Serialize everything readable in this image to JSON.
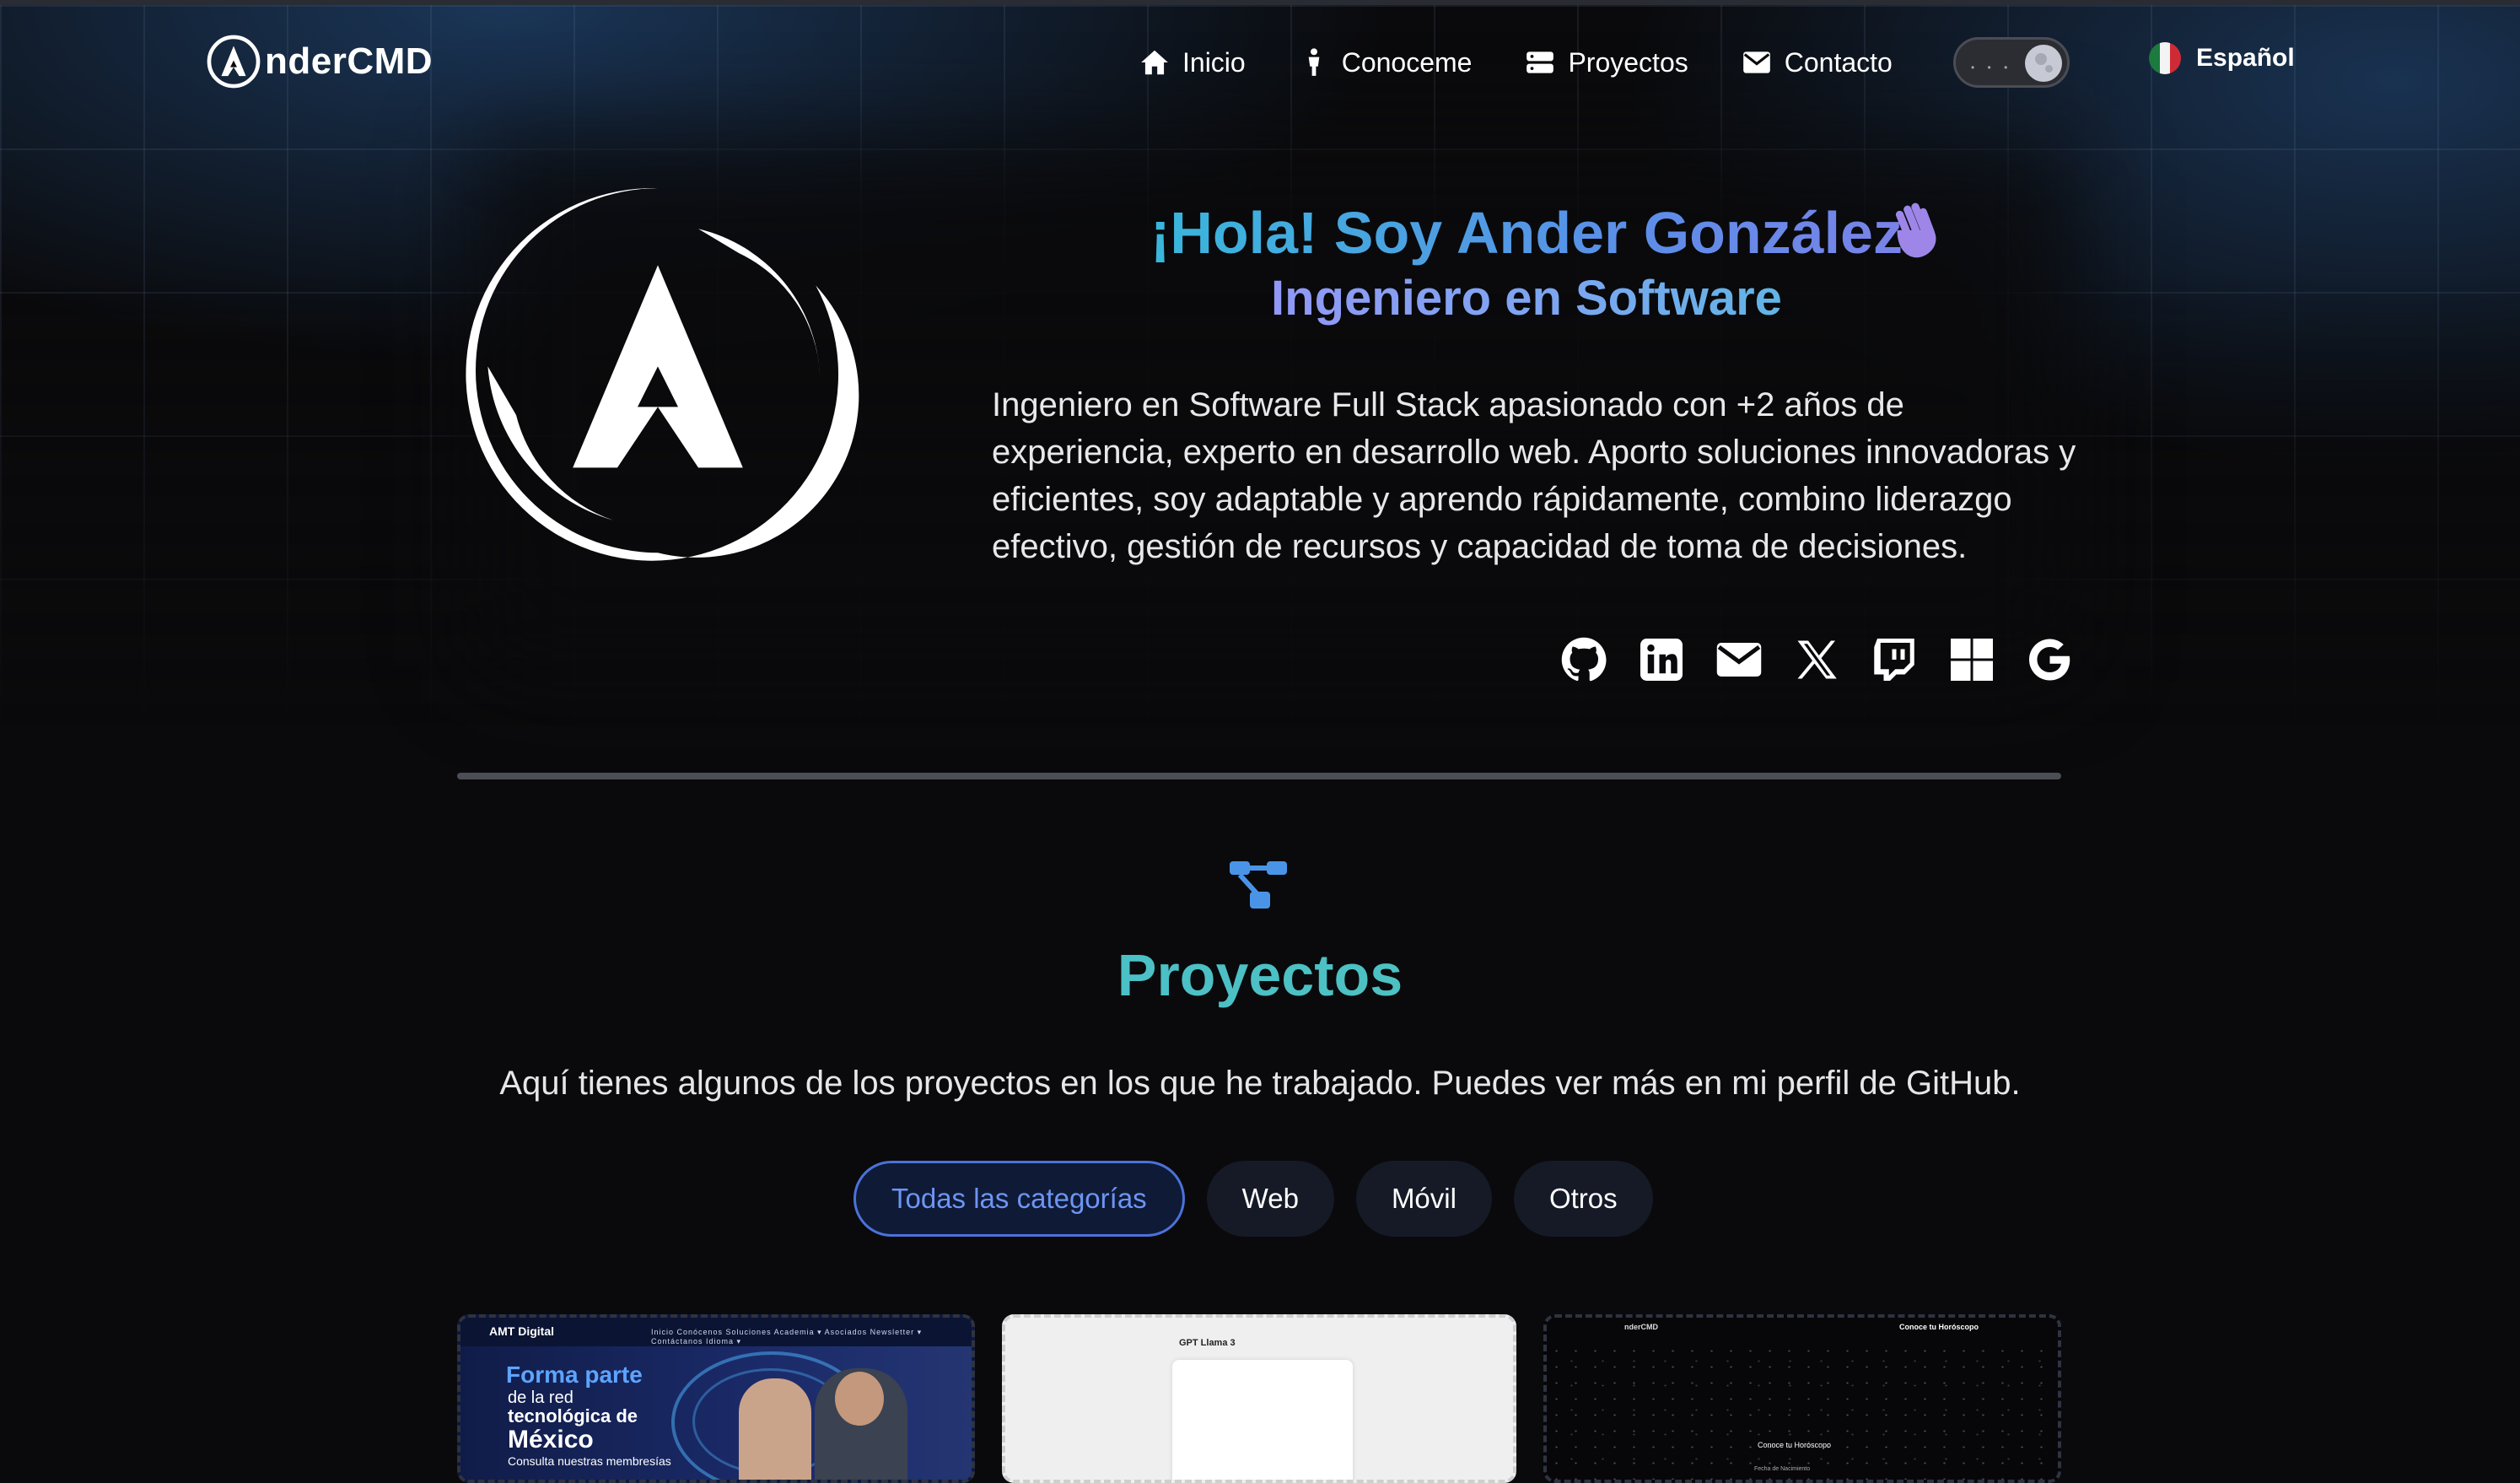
{
  "brand": {
    "name": "nderCMD"
  },
  "nav": {
    "items": [
      {
        "label": "Inicio",
        "icon": "home-icon"
      },
      {
        "label": "Conoceme",
        "icon": "person-icon"
      },
      {
        "label": "Proyectos",
        "icon": "server-icon"
      },
      {
        "label": "Contacto",
        "icon": "envelope-icon"
      }
    ],
    "theme_toggle_icon": "moon-icon",
    "language": "Español"
  },
  "hero": {
    "title": "¡Hola! Soy Ander González",
    "wave_icon": "waving-hand-icon",
    "subtitle": "Ingeniero en Software",
    "description": "Ingeniero en Software Full Stack apasionado con +2 años de experiencia, experto en desarrollo web. Aporto soluciones innovadoras y eficientes, soy adaptable y aprendo rápidamente, combino liderazgo efectivo, gestión de recursos y capacidad de toma de decisiones.",
    "socials": [
      "github-icon",
      "linkedin-icon",
      "email-icon",
      "x-icon",
      "twitch-icon",
      "windows-icon",
      "google-icon"
    ]
  },
  "projects": {
    "title": "Proyectos",
    "description": "Aquí tienes algunos de los proyectos en los que he trabajado. Puedes ver más en mi perfil de GitHub.",
    "filters": [
      "Todas las categorías",
      "Web",
      "Móvil",
      "Otros"
    ],
    "active_filter": "Todas las categorías",
    "cards": [
      {
        "brand": "AMT Digital",
        "nav_links": "Inicio  Conócenos  Soluciones  Academia ▾  Asociados  Newsletter ▾  Contáctanos  Idioma ▾",
        "line1": "Forma parte",
        "line2": "de la red",
        "line3": "tecnológica de",
        "line4": "México",
        "line5": "Consulta nuestras membresías"
      },
      {
        "title": "GPT Llama 3"
      },
      {
        "brand": "nderCMD",
        "title": "Conoce tu Horóscopo",
        "label": "Conoce tu Horóscopo",
        "sublabel": "Fecha de Nacimiento"
      }
    ]
  },
  "colors": {
    "background": "#0a0a0c",
    "accent_blue": "#5b8ee8",
    "accent_teal": "#3fc7d8",
    "accent_purple": "#a78bfa",
    "active_chip_border": "#4b72d8"
  }
}
